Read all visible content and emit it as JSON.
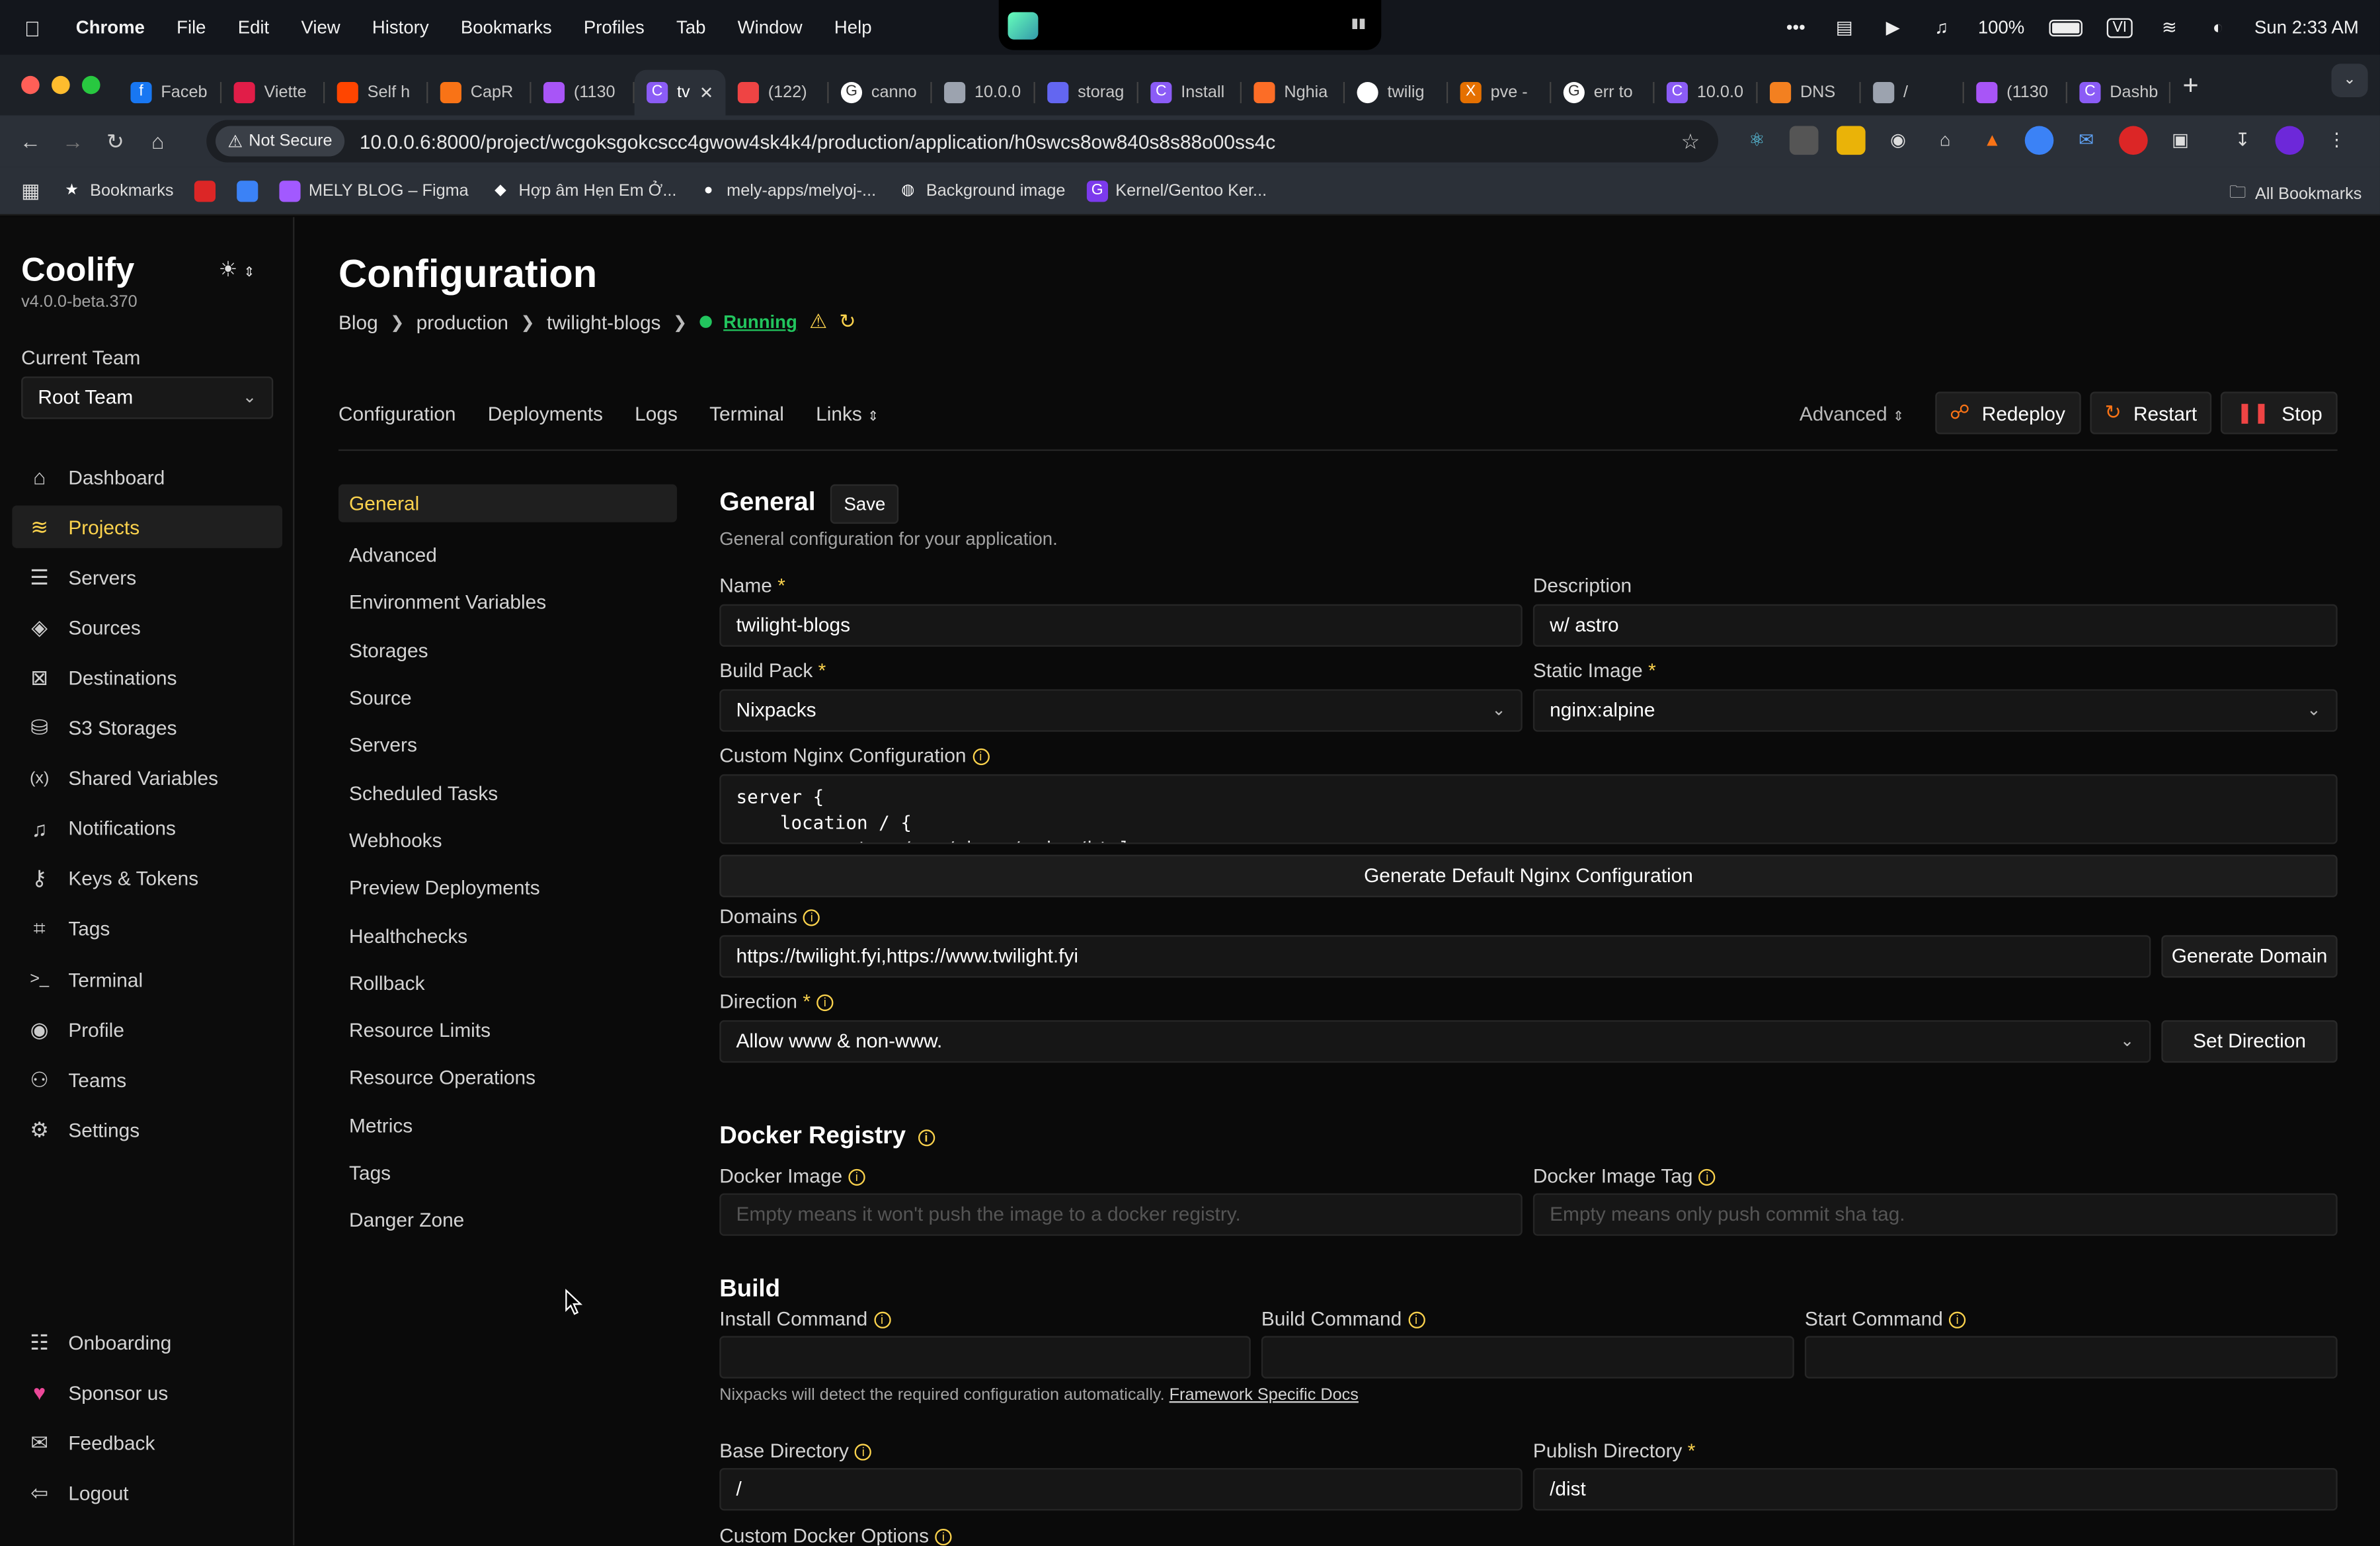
{
  "menubar": {
    "app": "Chrome",
    "items": [
      "File",
      "Edit",
      "View",
      "History",
      "Bookmarks",
      "Profiles",
      "Tab",
      "Window",
      "Help"
    ],
    "battery": "100%",
    "input_source": "VI",
    "clock": "Sun 2:33 AM"
  },
  "tabs": [
    {
      "label": "Faceb",
      "color": "#1877f2",
      "glyph": "f"
    },
    {
      "label": "Viette",
      "color": "#e11d48",
      "glyph": ""
    },
    {
      "label": "Self h",
      "color": "#ff4500",
      "glyph": ""
    },
    {
      "label": "CapR",
      "color": "#f97316",
      "glyph": ""
    },
    {
      "label": "(1130",
      "color": "#a855f7",
      "glyph": ""
    },
    {
      "label": "tv",
      "color": "#8b5cf6",
      "glyph": "C",
      "active": true
    },
    {
      "label": "(122)",
      "color": "#ef4444",
      "glyph": ""
    },
    {
      "label": "canno",
      "color": "#ffffff",
      "glyph": "G"
    },
    {
      "label": "10.0.0",
      "color": "#9ca3af",
      "glyph": ""
    },
    {
      "label": "storag",
      "color": "#6366f1",
      "glyph": ""
    },
    {
      "label": "Install",
      "color": "#8b5cf6",
      "glyph": "C"
    },
    {
      "label": "Nghia",
      "color": "#fc6d26",
      "glyph": ""
    },
    {
      "label": "twilig",
      "color": "#ffffff",
      "glyph": ""
    },
    {
      "label": "pve -",
      "color": "#e57000",
      "glyph": "X"
    },
    {
      "label": "err to",
      "color": "#ffffff",
      "glyph": "G"
    },
    {
      "label": "10.0.0",
      "color": "#8b5cf6",
      "glyph": "C"
    },
    {
      "label": "DNS",
      "color": "#f38020",
      "glyph": ""
    },
    {
      "label": "/",
      "color": "#9ca3af",
      "glyph": ""
    },
    {
      "label": "(1130",
      "color": "#a855f7",
      "glyph": ""
    },
    {
      "label": "Dashb",
      "color": "#8b5cf6",
      "glyph": "C"
    }
  ],
  "toolbar": {
    "security": "Not Secure",
    "url": "10.0.0.6:8000/project/wcgoksgokcscc4gwow4sk4k4/production/application/h0swcs8ow840s8s88o00ss4c"
  },
  "bookmarks": [
    {
      "label": "Bookmarks",
      "icon": "star-icon"
    },
    {
      "label": "",
      "icon": "red-icon"
    },
    {
      "label": "",
      "icon": "blue-icon"
    },
    {
      "label": "MELY BLOG – Figma",
      "icon": "figma-icon"
    },
    {
      "label": "Hợp âm Hẹn Em Ở...",
      "icon": "music-icon"
    },
    {
      "label": "mely-apps/melyoj-...",
      "icon": "github-icon"
    },
    {
      "label": "Background image",
      "icon": "globe-icon"
    },
    {
      "label": "Kernel/Gentoo Ker...",
      "icon": "gentoo-icon"
    }
  ],
  "all_bookmarks": "All Bookmarks",
  "sidebar": {
    "brand": "Coolify",
    "version": "v4.0.0-beta.370",
    "team_label": "Current Team",
    "team_value": "Root Team",
    "nav": [
      {
        "label": "Dashboard",
        "icon": "home-icon"
      },
      {
        "label": "Projects",
        "icon": "layers-icon",
        "active": true
      },
      {
        "label": "Servers",
        "icon": "server-icon"
      },
      {
        "label": "Sources",
        "icon": "git-icon"
      },
      {
        "label": "Destinations",
        "icon": "destination-icon"
      },
      {
        "label": "S3 Storages",
        "icon": "database-icon"
      },
      {
        "label": "Shared Variables",
        "icon": "variable-icon"
      },
      {
        "label": "Notifications",
        "icon": "bell-icon"
      },
      {
        "label": "Keys & Tokens",
        "icon": "key-icon"
      },
      {
        "label": "Tags",
        "icon": "tag-icon"
      },
      {
        "label": "Terminal",
        "icon": "terminal-icon"
      },
      {
        "label": "Profile",
        "icon": "user-icon"
      },
      {
        "label": "Teams",
        "icon": "team-icon"
      },
      {
        "label": "Settings",
        "icon": "gear-icon"
      }
    ],
    "bottom": [
      {
        "label": "Onboarding",
        "icon": "list-icon"
      },
      {
        "label": "Sponsor us",
        "icon": "heart-icon"
      },
      {
        "label": "Feedback",
        "icon": "chat-icon"
      },
      {
        "label": "Logout",
        "icon": "logout-icon"
      }
    ]
  },
  "page": {
    "title": "Configuration",
    "breadcrumb": [
      "Blog",
      "production",
      "twilight-blogs"
    ],
    "status": "Running",
    "tabs": [
      "Configuration",
      "Deployments",
      "Logs",
      "Terminal",
      "Links"
    ],
    "advanced": "Advanced",
    "redeploy": "Redeploy",
    "restart": "Restart",
    "stop": "Stop"
  },
  "subnav": [
    "General",
    "Advanced",
    "Environment Variables",
    "Storages",
    "Source",
    "Servers",
    "Scheduled Tasks",
    "Webhooks",
    "Preview Deployments",
    "Healthchecks",
    "Rollback",
    "Resource Limits",
    "Resource Operations",
    "Metrics",
    "Tags",
    "Danger Zone"
  ],
  "general": {
    "title": "General",
    "save": "Save",
    "description": "General configuration for your application.",
    "name_label": "Name",
    "name_value": "twilight-blogs",
    "desc_label": "Description",
    "desc_value": "w/ astro",
    "buildpack_label": "Build Pack",
    "buildpack_value": "Nixpacks",
    "static_label": "Static Image",
    "static_value": "nginx:alpine",
    "nginx_label": "Custom Nginx Configuration",
    "nginx_value": "server {\n    location / {\n        root   /usr/share/nginx/html;",
    "gen_nginx": "Generate Default Nginx Configuration",
    "domains_label": "Domains",
    "domains_value": "https://twilight.fyi,https://www.twilight.fyi",
    "gen_domain": "Generate Domain",
    "direction_label": "Direction",
    "direction_value": "Allow www & non-www.",
    "set_direction": "Set Direction"
  },
  "registry": {
    "title": "Docker Registry",
    "image_label": "Docker Image",
    "image_placeholder": "Empty means it won't push the image to a docker registry.",
    "tag_label": "Docker Image Tag",
    "tag_placeholder": "Empty means only push commit sha tag."
  },
  "build": {
    "title": "Build",
    "install_label": "Install Command",
    "build_label": "Build Command",
    "start_label": "Start Command",
    "note": "Nixpacks will detect the required configuration automatically.",
    "note_link": "Framework Specific Docs",
    "base_label": "Base Directory",
    "base_value": "/",
    "publish_label": "Publish Directory",
    "publish_value": "/dist",
    "docker_opts_label": "Custom Docker Options"
  }
}
